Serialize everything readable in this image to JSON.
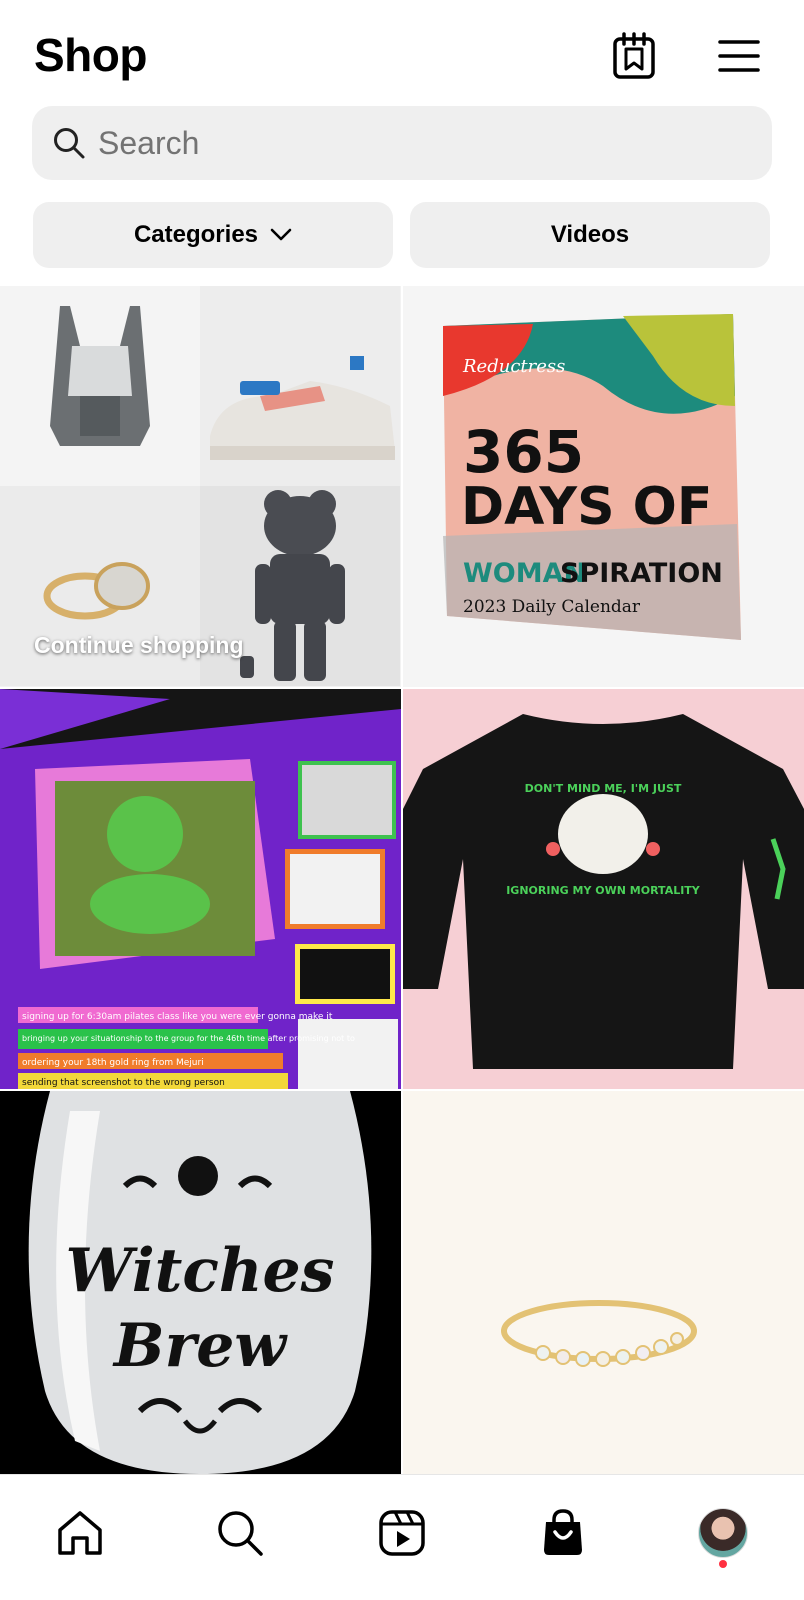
{
  "header": {
    "title": "Shop",
    "saved_icon": "saved-collection-icon",
    "menu_icon": "hamburger-menu-icon"
  },
  "search": {
    "placeholder": "Search",
    "value": "",
    "icon": "search-icon"
  },
  "filters": {
    "categories_label": "Categories",
    "videos_label": "Videos"
  },
  "grid": {
    "continue_label": "Continue shopping",
    "calendar": {
      "brand": "Reductress",
      "line1": "365",
      "line2": "DAYS OF",
      "line3a": "WOMAN",
      "line3b": "SPIRATION",
      "line4": "2023 Daily Calendar"
    },
    "meme_list": [
      "signing up for 6:30am pilates class like you were ever gonna make it",
      "bringing up your situationship to the group for the 46th time after promising not to",
      "ordering your 18th gold ring from Mejuri",
      "sending that screenshot to the wrong person"
    ],
    "shirt": {
      "top": "DON'T MIND ME, I'M JUST",
      "bottom": "IGNORING MY OWN MORTALITY"
    },
    "glass": {
      "line1": "Witches",
      "line2": "Brew"
    }
  },
  "bottom_nav": {
    "items": [
      "home-icon",
      "search-icon",
      "reels-icon",
      "shop-icon",
      "profile-avatar"
    ],
    "active": "shop-icon",
    "notification_color": "#ff3040"
  }
}
